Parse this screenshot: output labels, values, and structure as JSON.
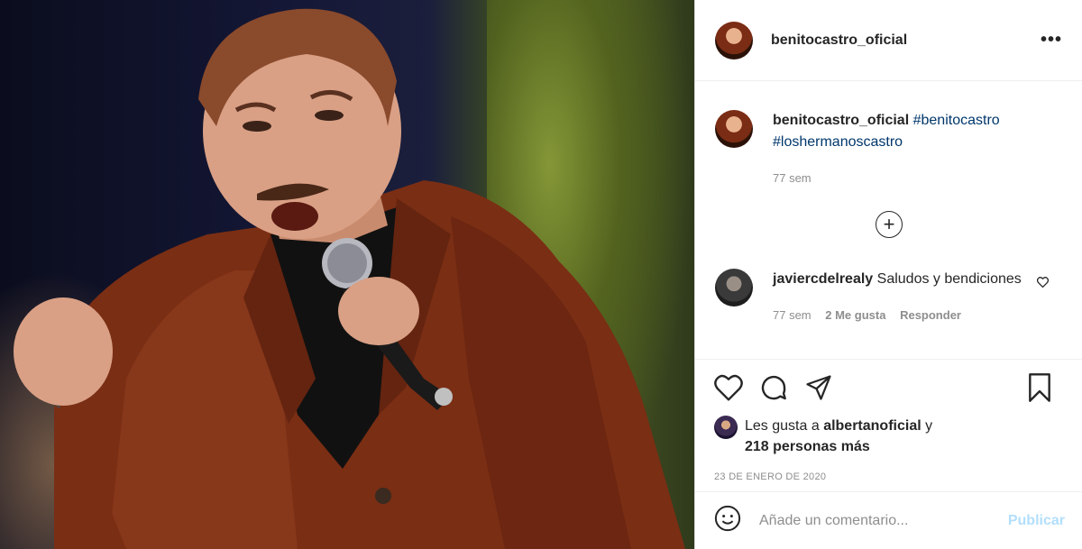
{
  "post": {
    "image_alt": "benitocastro_oficial photo"
  },
  "header": {
    "username": "benitocastro_oficial",
    "more_label": "•••"
  },
  "caption": {
    "username": "benitocastro_oficial",
    "hashtag_1": "#benitocastro",
    "hashtag_2": "#loshermanoscastro",
    "time": "77 sem"
  },
  "load_more": {
    "label": "+"
  },
  "comment": {
    "username": "javiercdelrealy",
    "text": "Saludos y bendiciones",
    "time": "77 sem",
    "likes": "2 Me gusta",
    "reply": "Responder"
  },
  "likes": {
    "prefix": "Les gusta a",
    "user": "albertanoficial",
    "suffix": "y",
    "others": "218 personas más"
  },
  "date": "23 DE ENERO DE 2020",
  "add_comment": {
    "placeholder": "Añade un comentario...",
    "publish": "Publicar"
  },
  "icons": {
    "more": "more-options-icon",
    "like": "heart-icon",
    "comment": "comment-icon",
    "share": "share-icon",
    "save": "bookmark-icon",
    "emoji": "emoji-icon",
    "comment_like": "heart-small-icon"
  },
  "colors": {
    "hashtag": "#00376b",
    "publish_disabled": "#b2dffc",
    "muted": "#8e8e8e"
  }
}
